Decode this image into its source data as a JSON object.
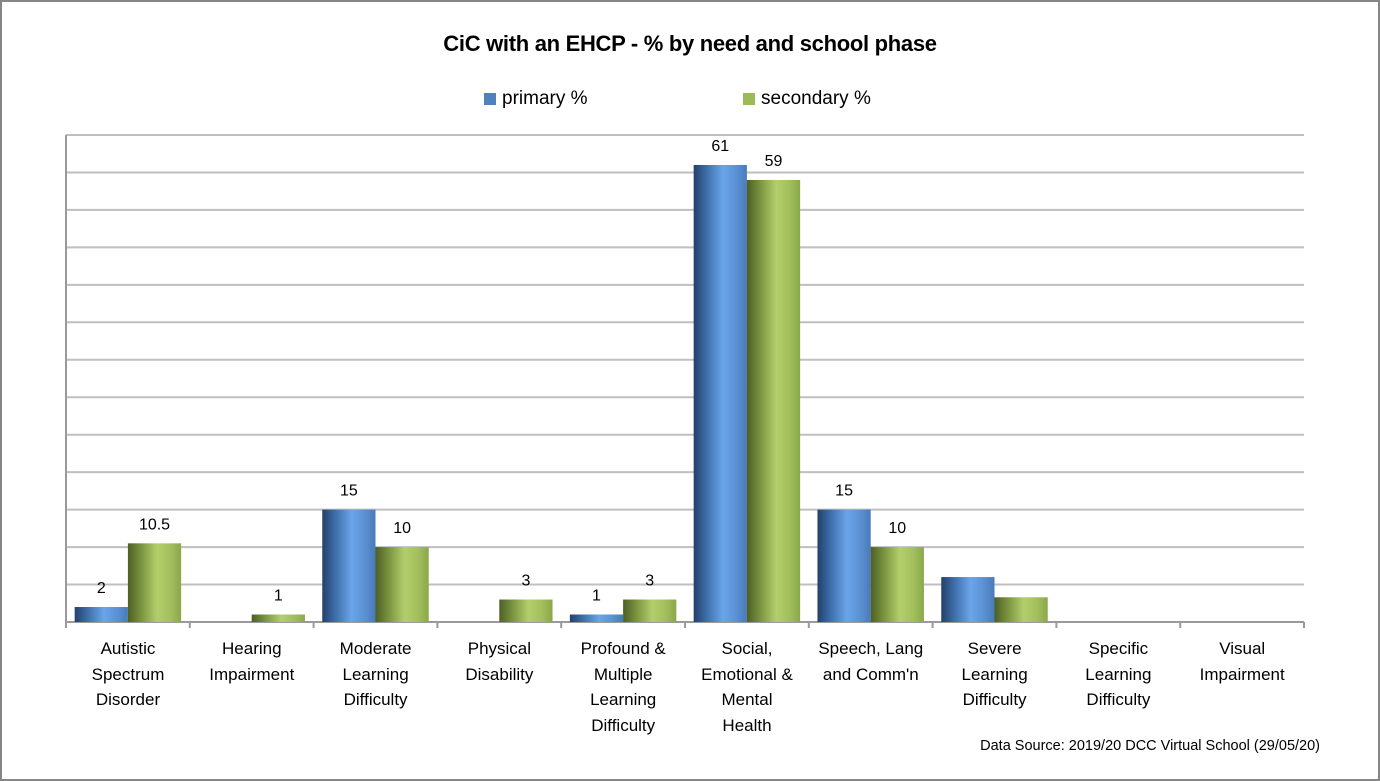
{
  "chart_data": {
    "type": "bar",
    "title": "CiC with an EHCP  - % by need and school phase",
    "xlabel": "",
    "ylabel": "",
    "ylim": [
      0,
      65
    ],
    "ytick_step": 5,
    "ytick_labels_visible": false,
    "grid": true,
    "legend_position": "top",
    "categories": [
      "Autistic Spectrum Disorder",
      "Hearing Impairment",
      "Moderate Learning Difficulty",
      "Physical Disability",
      "Profound & Multiple Learning Difficulty",
      "Social, Emotional & Mental Health",
      "Speech, Lang and Comm'n",
      "Severe Learning Difficulty",
      "Specific Learning Difficulty",
      "Visual Impairment"
    ],
    "category_display": [
      "Autistic\nSpectrum\nDisorder",
      "Hearing\nImpairment",
      "Moderate\nLearning\nDifficulty",
      "Physical\nDisability",
      "Profound &\nMultiple\nLearning\nDifficulty",
      "Social,\nEmotional &\nMental\nHealth",
      "Speech, Lang\nand Comm'n",
      "Severe\nLearning\nDifficulty",
      "Specific\nLearning\nDifficulty",
      "Visual\nImpairment"
    ],
    "series": [
      {
        "name": "primary %",
        "color": "#4f81bd",
        "values": [
          2,
          0,
          15,
          0,
          1,
          61,
          15,
          6,
          0,
          0
        ],
        "data_labels": [
          "2",
          "",
          "15",
          "",
          "1",
          "61",
          "15",
          "",
          "",
          ""
        ]
      },
      {
        "name": "secondary %",
        "color": "#9bbb59",
        "values": [
          10.5,
          1,
          10,
          3,
          3,
          59,
          10,
          3.3,
          0,
          0
        ],
        "data_labels": [
          "10.5",
          "1",
          "10",
          "3",
          "3",
          "59",
          "10",
          "",
          "",
          ""
        ]
      }
    ],
    "source": "Data Source: 2019/20 DCC Virtual School (29/05/20)"
  }
}
